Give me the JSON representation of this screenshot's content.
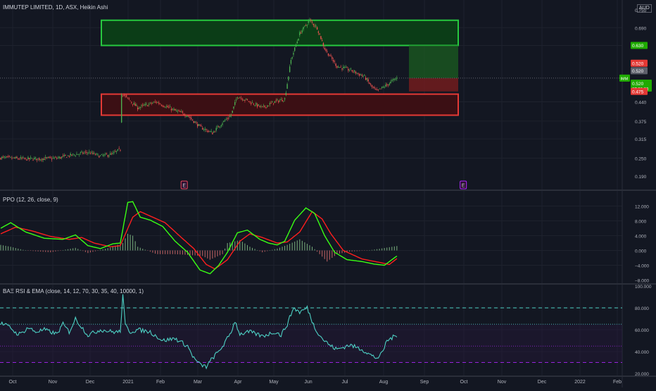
{
  "header": {
    "symbol_line": "IMMUTEP LIMITED, 1D, ASX, Heikin Ashi",
    "currency": "AUD",
    "ppo_title": "PPO (12, 26, close, 9)",
    "rsi_title": "BAΞ RSI & EMA (close, 14, 12, 70, 30, 35, 40, 10000, 1)"
  },
  "badges": {
    "ticker": "IMM",
    "price": "0.520",
    "countdown": "07:32:20",
    "target": "0.630",
    "entry": "0.520",
    "current": "0.520",
    "stop": "0.475"
  },
  "events": [
    "E",
    "E"
  ],
  "colors": {
    "bg": "#131722",
    "grid": "#1e222d",
    "up": "#4caf50",
    "down": "#ef5350",
    "zone_green_fill": "#0b3d17",
    "zone_green_border": "#27c93f",
    "zone_red_fill": "#3b0f14",
    "zone_red_border": "#e53935",
    "ppo": "#39ff14",
    "signal": "#ff1e1e",
    "rsi": "#4dd0c4",
    "level_teal": "#4dd0c4",
    "level_purple": "#b026ff"
  },
  "chart_data": [
    {
      "type": "candlestick",
      "title": "IMMUTEP LIMITED, 1D, ASX, Heikin Ashi",
      "y_ticks": [
        0.75,
        0.69,
        0.63,
        0.52,
        0.475,
        0.44,
        0.375,
        0.315,
        0.25,
        0.19
      ],
      "y_tick_labels": [
        "0.750",
        "0.690",
        "0.630",
        "0.520",
        "0.475",
        "0.440",
        "0.375",
        "0.315",
        "0.250",
        "0.190"
      ],
      "x_labels": [
        "Oct",
        "Nov",
        "Dec",
        "2021",
        "Feb",
        "Mar",
        "Apr",
        "May",
        "Jun",
        "Jul",
        "Aug",
        "Sep",
        "Oct",
        "Nov",
        "Dec",
        "2022",
        "Feb"
      ],
      "price_keypoints": [
        [
          0,
          0.252
        ],
        [
          20,
          0.247
        ],
        [
          45,
          0.25
        ],
        [
          60,
          0.263
        ],
        [
          70,
          0.27
        ],
        [
          80,
          0.257
        ],
        [
          90,
          0.264
        ],
        [
          96,
          0.28
        ],
        [
          97,
          0.47
        ],
        [
          110,
          0.42
        ],
        [
          125,
          0.44
        ],
        [
          140,
          0.41
        ],
        [
          150,
          0.395
        ],
        [
          160,
          0.355
        ],
        [
          170,
          0.335
        ],
        [
          178,
          0.37
        ],
        [
          185,
          0.395
        ],
        [
          190,
          0.46
        ],
        [
          200,
          0.44
        ],
        [
          210,
          0.42
        ],
        [
          220,
          0.44
        ],
        [
          228,
          0.45
        ],
        [
          233,
          0.58
        ],
        [
          240,
          0.67
        ],
        [
          248,
          0.715
        ],
        [
          254,
          0.69
        ],
        [
          260,
          0.62
        ],
        [
          270,
          0.56
        ],
        [
          282,
          0.545
        ],
        [
          292,
          0.525
        ],
        [
          298,
          0.49
        ],
        [
          302,
          0.475
        ],
        [
          310,
          0.497
        ],
        [
          318,
          0.52
        ]
      ],
      "zones": [
        {
          "name": "resistance",
          "from": 0.63,
          "to": 0.715
        },
        {
          "name": "support",
          "from": 0.395,
          "to": 0.466
        }
      ],
      "trade": {
        "entry": 0.52,
        "target": 0.63,
        "stop": 0.475
      },
      "event_markers": [
        {
          "label": "E",
          "bar": 147
        },
        {
          "label": "E",
          "bar": 371
        }
      ]
    },
    {
      "type": "line",
      "title": "PPO (12, 26, close, 9)",
      "y_ticks": [
        12,
        8,
        4,
        0,
        -4,
        -8
      ],
      "y_tick_labels": [
        "12.000",
        "8.000",
        "4.000",
        "0.000",
        "−4.000",
        "−8.000"
      ],
      "ylim": [
        -8,
        14
      ],
      "series": [
        {
          "key": "ppo",
          "keypoints": [
            [
              0,
              6
            ],
            [
              8,
              7.5
            ],
            [
              20,
              5
            ],
            [
              35,
              3.3
            ],
            [
              50,
              3
            ],
            [
              60,
              4.2
            ],
            [
              70,
              1.3
            ],
            [
              80,
              0.5
            ],
            [
              90,
              1.8
            ],
            [
              96,
              2
            ],
            [
              102,
              13
            ],
            [
              106,
              13.2
            ],
            [
              112,
              9
            ],
            [
              120,
              8.2
            ],
            [
              130,
              6.5
            ],
            [
              140,
              2.5
            ],
            [
              150,
              -0.5
            ],
            [
              160,
              -5.3
            ],
            [
              168,
              -6.3
            ],
            [
              175,
              -4
            ],
            [
              182,
              -0.5
            ],
            [
              190,
              4.8
            ],
            [
              198,
              5.5
            ],
            [
              208,
              3
            ],
            [
              215,
              2
            ],
            [
              222,
              1.5
            ],
            [
              228,
              2.5
            ],
            [
              236,
              8.2
            ],
            [
              245,
              11.5
            ],
            [
              252,
              10
            ],
            [
              260,
              4
            ],
            [
              268,
              -0.5
            ],
            [
              278,
              -2.5
            ],
            [
              290,
              -3
            ],
            [
              300,
              -3.7
            ],
            [
              308,
              -4
            ],
            [
              318,
              -1.5
            ]
          ]
        },
        {
          "key": "signal",
          "keypoints": [
            [
              0,
              4.5
            ],
            [
              12,
              6.3
            ],
            [
              25,
              5.3
            ],
            [
              40,
              3.8
            ],
            [
              55,
              3
            ],
            [
              65,
              3.5
            ],
            [
              75,
              2
            ],
            [
              88,
              1
            ],
            [
              96,
              1.3
            ],
            [
              106,
              9
            ],
            [
              112,
              10.5
            ],
            [
              120,
              9.3
            ],
            [
              132,
              7.5
            ],
            [
              145,
              3.5
            ],
            [
              155,
              0.5
            ],
            [
              165,
              -3.8
            ],
            [
              172,
              -5
            ],
            [
              182,
              -2.5
            ],
            [
              192,
              2.5
            ],
            [
              200,
              4.5
            ],
            [
              210,
              3.5
            ],
            [
              222,
              2
            ],
            [
              230,
              2.3
            ],
            [
              240,
              5
            ],
            [
              250,
              10.5
            ],
            [
              258,
              8.5
            ],
            [
              265,
              4.5
            ],
            [
              275,
              0
            ],
            [
              290,
              -2.3
            ],
            [
              305,
              -3.3
            ],
            [
              312,
              -3.8
            ],
            [
              318,
              -2.2
            ]
          ]
        },
        {
          "key": "histogram",
          "keypoints": [
            [
              0,
              1.5
            ],
            [
              8,
              1
            ],
            [
              20,
              0
            ],
            [
              40,
              -0.5
            ],
            [
              60,
              0.7
            ],
            [
              70,
              -0.7
            ],
            [
              88,
              0.8
            ],
            [
              98,
              2
            ],
            [
              102,
              4.5
            ],
            [
              106,
              4
            ],
            [
              110,
              1
            ],
            [
              125,
              -1
            ],
            [
              140,
              -1
            ],
            [
              150,
              -1.2
            ],
            [
              162,
              -1.5
            ],
            [
              168,
              -2.5
            ],
            [
              178,
              -1
            ],
            [
              182,
              2
            ],
            [
              192,
              2.8
            ],
            [
              200,
              1
            ],
            [
              210,
              -0.5
            ],
            [
              222,
              0.5
            ],
            [
              230,
              1.5
            ],
            [
              240,
              3
            ],
            [
              250,
              1
            ],
            [
              256,
              -1
            ],
            [
              262,
              -3
            ],
            [
              270,
              -1
            ],
            [
              280,
              -0.3
            ],
            [
              295,
              0
            ],
            [
              305,
              0.5
            ],
            [
              318,
              1.2
            ]
          ]
        }
      ]
    },
    {
      "type": "line",
      "title": "BAΞ RSI & EMA (close, 14, 12, 70, 30, 35, 40, 10000, 1)",
      "y_ticks": [
        100,
        80,
        60,
        40,
        20
      ],
      "y_tick_labels": [
        "100.000",
        "80.000",
        "60.000",
        "40.000",
        "20.000"
      ],
      "ylim": [
        20,
        100
      ],
      "levels": [
        80,
        65,
        45,
        30
      ],
      "series": [
        {
          "key": "rsi",
          "keypoints": [
            [
              0,
              66
            ],
            [
              8,
              62
            ],
            [
              12,
              57
            ],
            [
              16,
              56
            ],
            [
              22,
              62
            ],
            [
              28,
              58
            ],
            [
              35,
              60
            ],
            [
              45,
              56
            ],
            [
              50,
              65
            ],
            [
              55,
              58
            ],
            [
              60,
              70
            ],
            [
              64,
              64
            ],
            [
              70,
              55
            ],
            [
              80,
              60
            ],
            [
              90,
              58
            ],
            [
              96,
              58
            ],
            [
              98,
              92
            ],
            [
              100,
              64
            ],
            [
              104,
              58
            ],
            [
              110,
              60
            ],
            [
              120,
              58
            ],
            [
              130,
              50
            ],
            [
              140,
              52
            ],
            [
              150,
              45
            ],
            [
              155,
              34
            ],
            [
              160,
              28
            ],
            [
              165,
              26
            ],
            [
              170,
              34
            ],
            [
              175,
              40
            ],
            [
              180,
              48
            ],
            [
              185,
              58
            ],
            [
              188,
              68
            ],
            [
              192,
              56
            ],
            [
              200,
              58
            ],
            [
              210,
              54
            ],
            [
              220,
              58
            ],
            [
              225,
              55
            ],
            [
              230,
              65
            ],
            [
              235,
              80
            ],
            [
              240,
              76
            ],
            [
              246,
              80
            ],
            [
              252,
              62
            ],
            [
              258,
              52
            ],
            [
              265,
              45
            ],
            [
              270,
              42
            ],
            [
              280,
              46
            ],
            [
              290,
              42
            ],
            [
              298,
              36
            ],
            [
              302,
              34
            ],
            [
              306,
              38
            ],
            [
              310,
              50
            ],
            [
              318,
              55
            ]
          ]
        }
      ]
    }
  ]
}
